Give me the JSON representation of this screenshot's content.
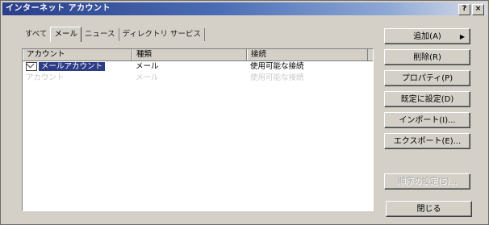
{
  "window": {
    "title": "インターネット アカウント",
    "help_btn": "?",
    "close_btn": "×"
  },
  "tabs": [
    {
      "label": "すべて"
    },
    {
      "label": "メール"
    },
    {
      "label": "ニュース"
    },
    {
      "label": "ディレクトリ サービス"
    }
  ],
  "list": {
    "columns": [
      "アカウント",
      "種類",
      "接続"
    ],
    "rows": [
      {
        "account": "メールアカウント",
        "type": "メール",
        "connection": "使用可能な接続"
      },
      {
        "account": "アカウント",
        "type": "メール",
        "connection": "使用可能な接続"
      }
    ]
  },
  "buttons": {
    "add": "追加(A)",
    "remove": "削除(R)",
    "properties": "プロパティ(P)",
    "set_default": "既定に設定(D)",
    "import": "インポート(I)...",
    "export": "エクスポート(E)...",
    "set_order": "順序の設定(S)...",
    "close": "閉じる"
  }
}
